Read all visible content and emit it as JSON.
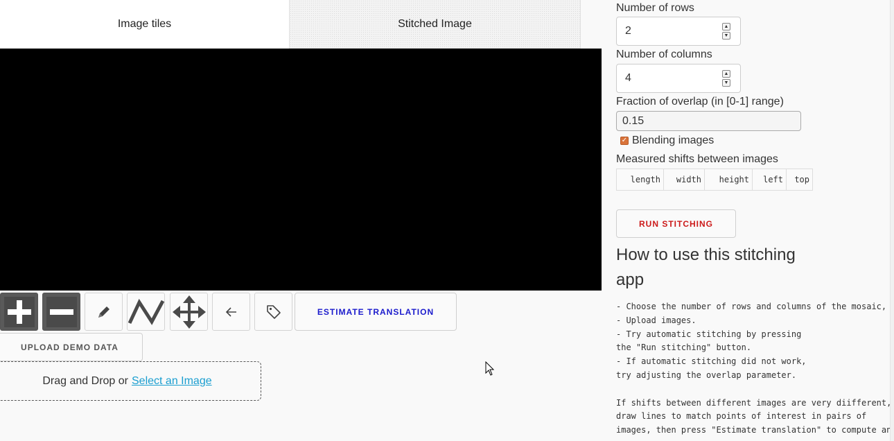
{
  "tabs": {
    "image_tiles": "Image tiles",
    "stitched_image": "Stitched Image"
  },
  "toolbar": {
    "estimate_label": "Estimate translation",
    "upload_demo_label": "Upload demo data",
    "tools": [
      "zoom-in",
      "zoom-out",
      "pencil",
      "polyline",
      "pan",
      "undo",
      "tag"
    ]
  },
  "dropzone": {
    "text": "Drag and Drop or",
    "link": "Select an Image"
  },
  "panel": {
    "rows_label": "Number of rows",
    "rows_value": "2",
    "cols_label": "Number of columns",
    "cols_value": "4",
    "overlap_label": "Fraction of overlap (in [0-1] range)",
    "overlap_value": "0.15",
    "blending_label": "Blending images",
    "blending_checked": true,
    "shifts_label": "Measured shifts between images",
    "shifts_columns": [
      "length",
      "width",
      "height",
      "left",
      "top"
    ],
    "run_label": "Run stitching",
    "howto_title": "How to use this stitching app",
    "howto_text": "- Choose the number of rows and columns of the mosaic,\n- Upload images.\n- Try automatic stitching by pressing\nthe \"Run stitching\" button.\n- If automatic stitching did not work,\ntry adjusting the overlap parameter.\n\nIf shifts between different images are very diifferent,\ndraw lines to match points of interest in pairs of\nimages, then press \"Estimate translation\" to compute an"
  },
  "colors": {
    "estimate_text": "#1a1acc",
    "run_text": "#cc1a1a",
    "checkbox": "#d9733a",
    "link": "#1a9ed0"
  }
}
